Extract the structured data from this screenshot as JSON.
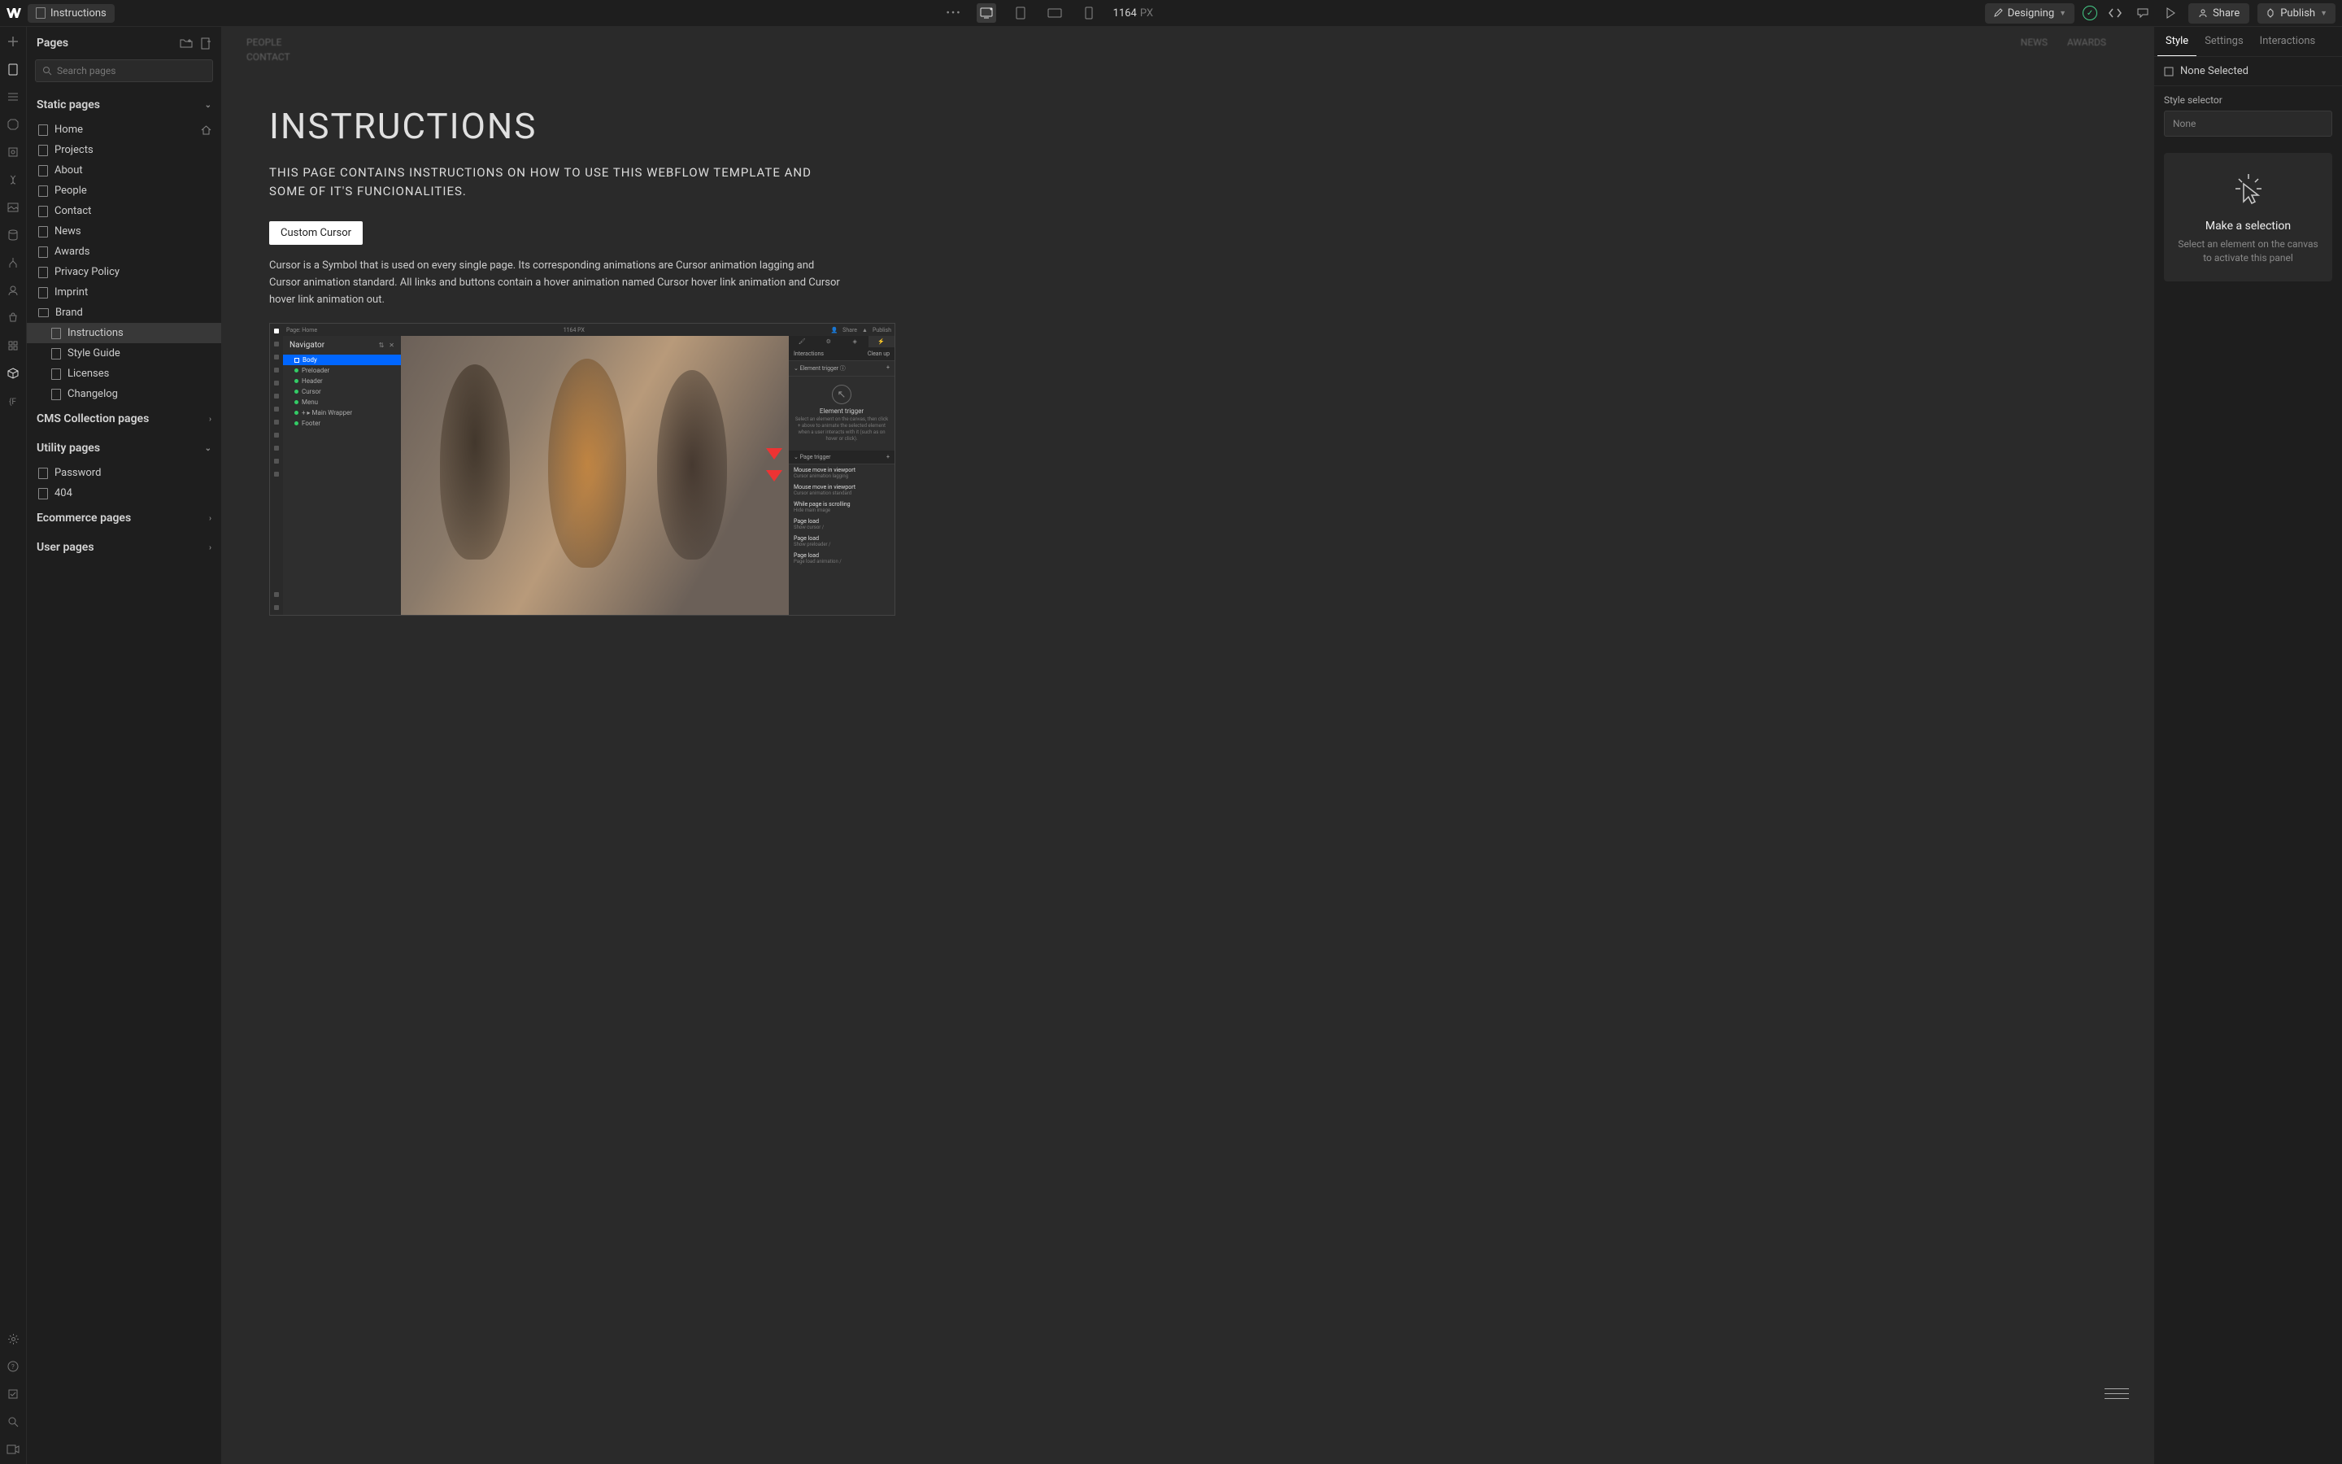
{
  "topbar": {
    "pageName": "Instructions",
    "viewportWidth": "1164",
    "viewportUnit": "PX",
    "designing": "Designing",
    "share": "Share",
    "publish": "Publish"
  },
  "leftPanel": {
    "title": "Pages",
    "searchPlaceholder": "Search pages",
    "sections": {
      "static": "Static pages",
      "cms": "CMS Collection pages",
      "utility": "Utility pages",
      "ecommerce": "Ecommerce pages",
      "user": "User pages"
    },
    "staticPages": [
      {
        "label": "Home",
        "isHome": true
      },
      {
        "label": "Projects"
      },
      {
        "label": "About"
      },
      {
        "label": "People"
      },
      {
        "label": "Contact"
      },
      {
        "label": "News"
      },
      {
        "label": "Awards"
      },
      {
        "label": "Privacy Policy"
      },
      {
        "label": "Imprint"
      },
      {
        "label": "Brand",
        "isFolder": true
      },
      {
        "label": "Instructions",
        "nested": true,
        "active": true
      },
      {
        "label": "Style Guide",
        "nested": true
      },
      {
        "label": "Licenses",
        "nested": true
      },
      {
        "label": "Changelog",
        "nested": true
      }
    ],
    "utilityPages": [
      {
        "label": "Password"
      },
      {
        "label": "404"
      }
    ]
  },
  "canvas": {
    "navLeft": [
      "PEOPLE",
      "CONTACT"
    ],
    "navRight": [
      "NEWS",
      "AWARDS"
    ],
    "heading": "INSTRUCTIONS",
    "subheading": "THIS PAGE CONTAINS INSTRUCTIONS ON HOW TO USE THIS WEBFLOW TEMPLATE AND SOME OF IT'S FUNCIONALITIES.",
    "customCursorBtn": "Custom Cursor",
    "bodyText": "Cursor is a Symbol that is used on every single page. Its corresponding animations are Cursor animation lagging and Cursor animation standard. All links and buttons contain a hover animation named Cursor hover link animation and Cursor hover link animation out.",
    "embedded": {
      "topbar": {
        "page": "Page: Home",
        "width": "1164 PX",
        "share": "Share",
        "publish": "Publish"
      },
      "navigatorTitle": "Navigator",
      "navItems": [
        {
          "label": "Body",
          "selected": true,
          "square": true
        },
        {
          "label": "Preloader"
        },
        {
          "label": "Header"
        },
        {
          "label": "Cursor"
        },
        {
          "label": "Menu"
        },
        {
          "label": "Main Wrapper",
          "plus": true
        },
        {
          "label": "Footer"
        }
      ],
      "rightPanel": {
        "interactionsHeader": "Interactions",
        "cleanUp": "Clean up",
        "elementTriggerLabel": "Element trigger",
        "elementTriggerTitle": "Element trigger",
        "elementTriggerDesc": "Select an element on the canvas, then click + above to animate the selected element when a user interacts with it (such as on hover or click).",
        "pageTriggerLabel": "Page trigger",
        "items": [
          {
            "title": "Mouse move in viewport",
            "sub": "Cursor animation lagging"
          },
          {
            "title": "Mouse move in viewport",
            "sub": "Cursor animation standard"
          },
          {
            "title": "While page is scrolling",
            "sub": "Hide main image"
          },
          {
            "title": "Page load",
            "sub": "Show cursor / <none>"
          },
          {
            "title": "Page load",
            "sub": "Show preloader / <none>"
          },
          {
            "title": "Page load",
            "sub": "Page load animation / <none>"
          }
        ]
      }
    }
  },
  "rightPanel": {
    "tabs": [
      "Style",
      "Settings",
      "Interactions"
    ],
    "activeTab": "Style",
    "noneSelected": "None Selected",
    "styleSelector": "Style selector",
    "styleSelectorValue": "None",
    "emptyTitle": "Make a selection",
    "emptyDesc": "Select an element on the canvas to activate this panel"
  }
}
